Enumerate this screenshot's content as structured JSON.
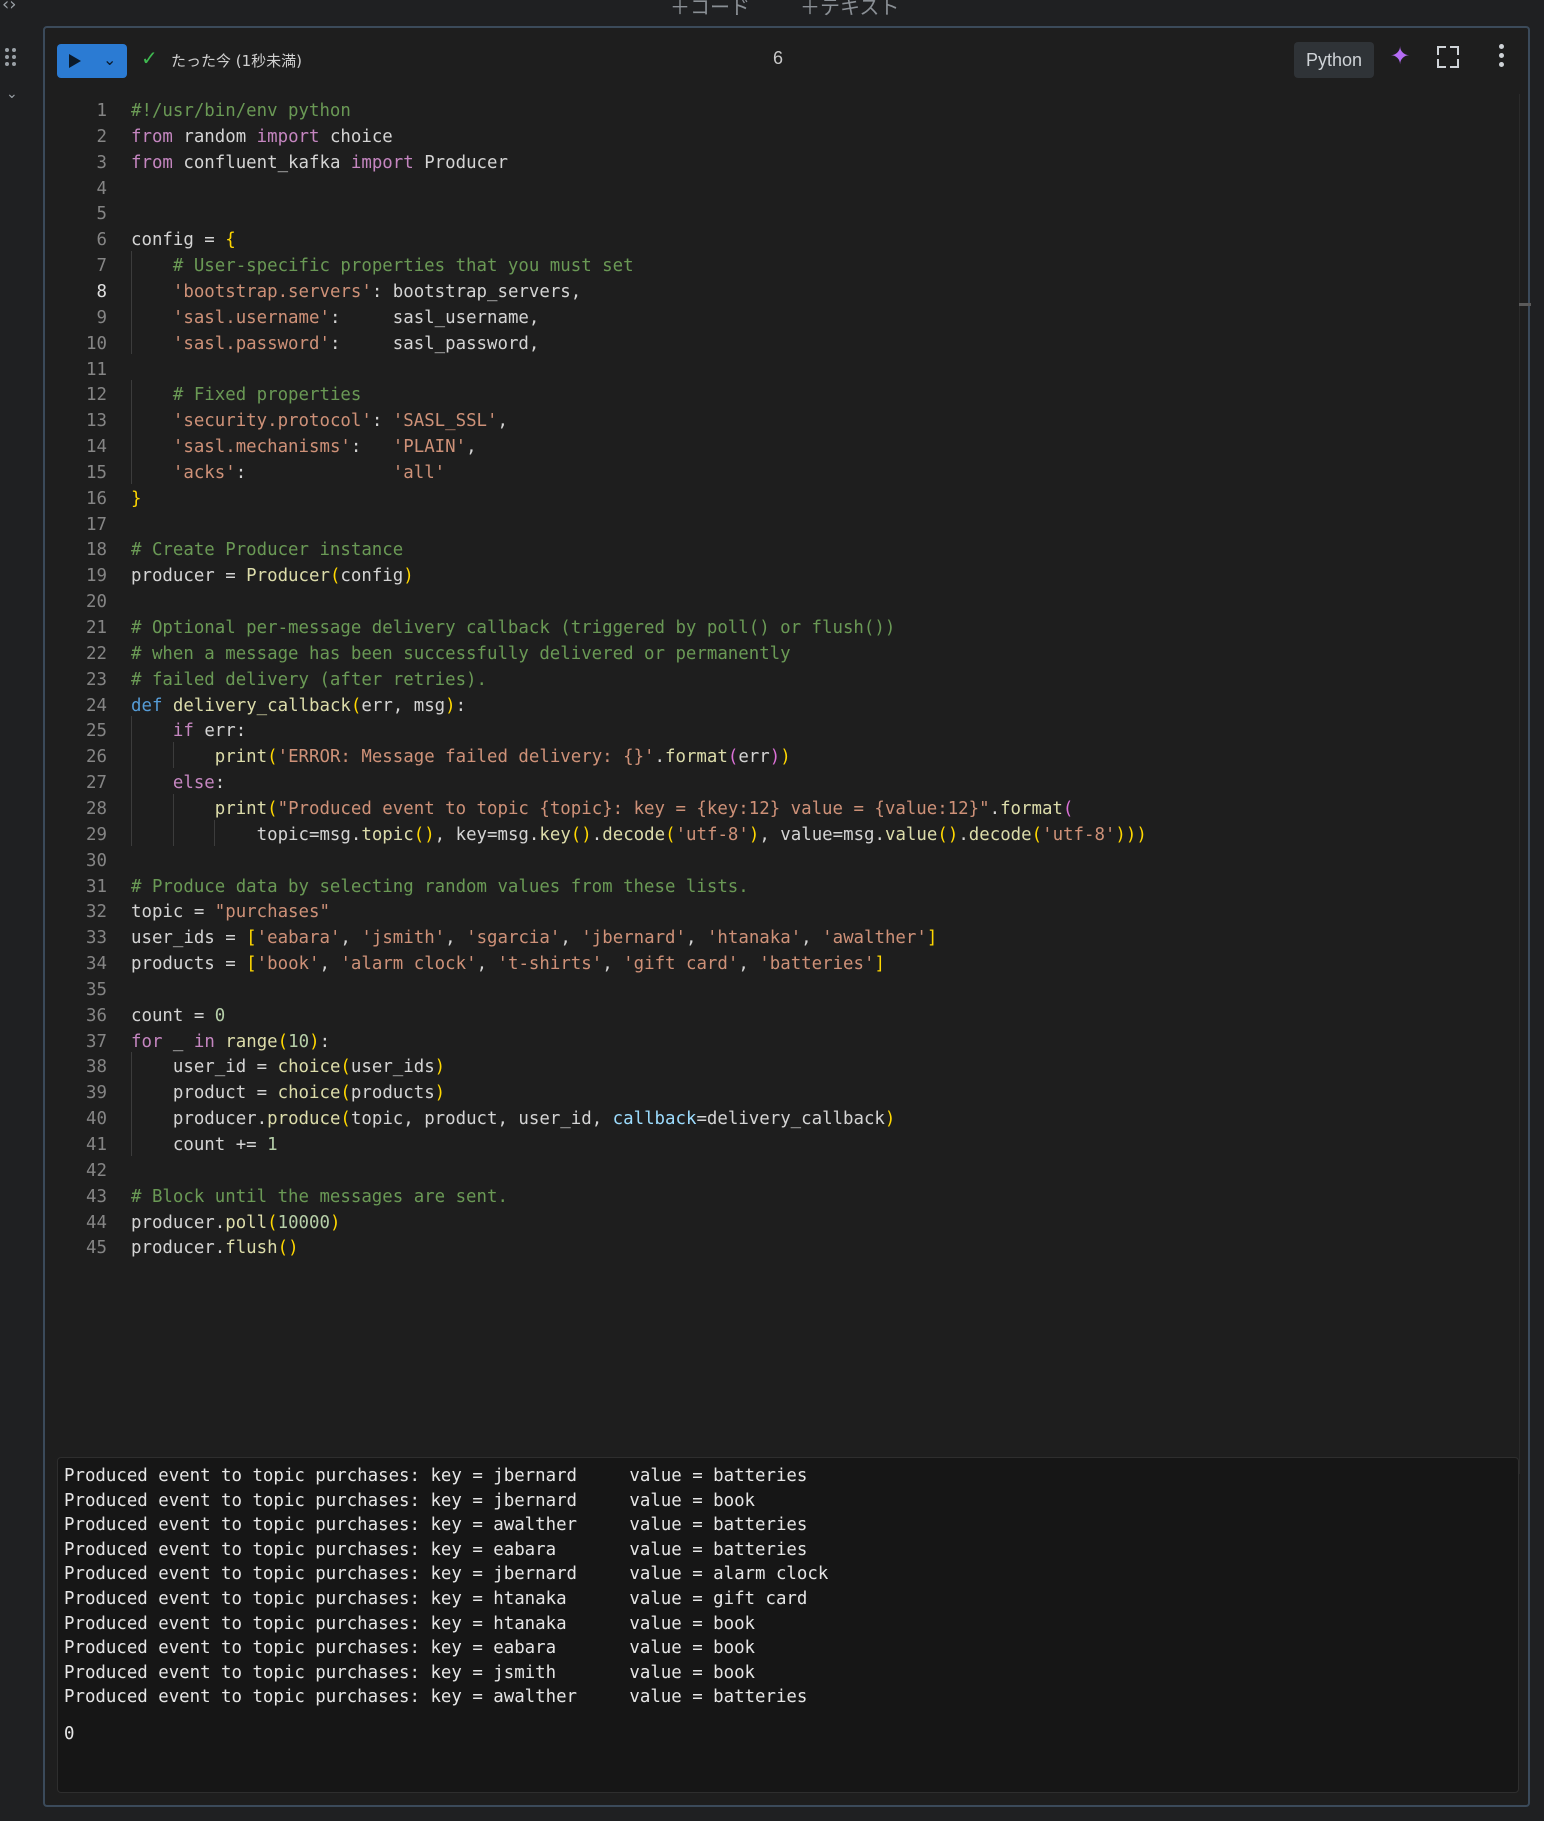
{
  "top": {
    "add_code": "＋コード",
    "add_text": "＋テキスト"
  },
  "toolbar": {
    "status": "たった今 (1秒未満)",
    "execution_count": "6",
    "language": "Python"
  },
  "icons": {
    "run": "play-icon",
    "run_menu": "chevron-down-icon",
    "status": "check-icon",
    "ai": "sparkle-icon",
    "expand": "fullscreen-icon",
    "more": "more-vertical-icon"
  },
  "colors": {
    "run_button": "#2b7bd3",
    "success": "#3fb950",
    "sparkle": "#b56cf5"
  },
  "code": {
    "active_line": 8,
    "lines": [
      "#!/usr/bin/env python",
      "from random import choice",
      "from confluent_kafka import Producer",
      "",
      "",
      "config = {",
      "    # User-specific properties that you must set",
      "    'bootstrap.servers': bootstrap_servers,",
      "    'sasl.username':     sasl_username,",
      "    'sasl.password':     sasl_password,",
      "",
      "    # Fixed properties",
      "    'security.protocol': 'SASL_SSL',",
      "    'sasl.mechanisms':   'PLAIN',",
      "    'acks':              'all'",
      "}",
      "",
      "# Create Producer instance",
      "producer = Producer(config)",
      "",
      "# Optional per-message delivery callback (triggered by poll() or flush())",
      "# when a message has been successfully delivered or permanently",
      "# failed delivery (after retries).",
      "def delivery_callback(err, msg):",
      "    if err:",
      "        print('ERROR: Message failed delivery: {}'.format(err))",
      "    else:",
      "        print(\"Produced event to topic {topic}: key = {key:12} value = {value:12}\".format(",
      "            topic=msg.topic(), key=msg.key().decode('utf-8'), value=msg.value().decode('utf-8')))",
      "",
      "# Produce data by selecting random values from these lists.",
      "topic = \"purchases\"",
      "user_ids = ['eabara', 'jsmith', 'sgarcia', 'jbernard', 'htanaka', 'awalther']",
      "products = ['book', 'alarm clock', 't-shirts', 'gift card', 'batteries']",
      "",
      "count = 0",
      "for _ in range(10):",
      "    user_id = choice(user_ids)",
      "    product = choice(products)",
      "    producer.produce(topic, product, user_id, callback=delivery_callback)",
      "    count += 1",
      "",
      "# Block until the messages are sent.",
      "producer.poll(10000)",
      "producer.flush()"
    ]
  },
  "output": {
    "lines": [
      "Produced event to topic purchases: key = jbernard     value = batteries",
      "Produced event to topic purchases: key = jbernard     value = book",
      "Produced event to topic purchases: key = awalther     value = batteries",
      "Produced event to topic purchases: key = eabara       value = batteries",
      "Produced event to topic purchases: key = jbernard     value = alarm clock",
      "Produced event to topic purchases: key = htanaka      value = gift card",
      "Produced event to topic purchases: key = htanaka      value = book",
      "Produced event to topic purchases: key = eabara       value = book",
      "Produced event to topic purchases: key = jsmith       value = book",
      "Produced event to topic purchases: key = awalther     value = batteries"
    ],
    "result": "0"
  }
}
